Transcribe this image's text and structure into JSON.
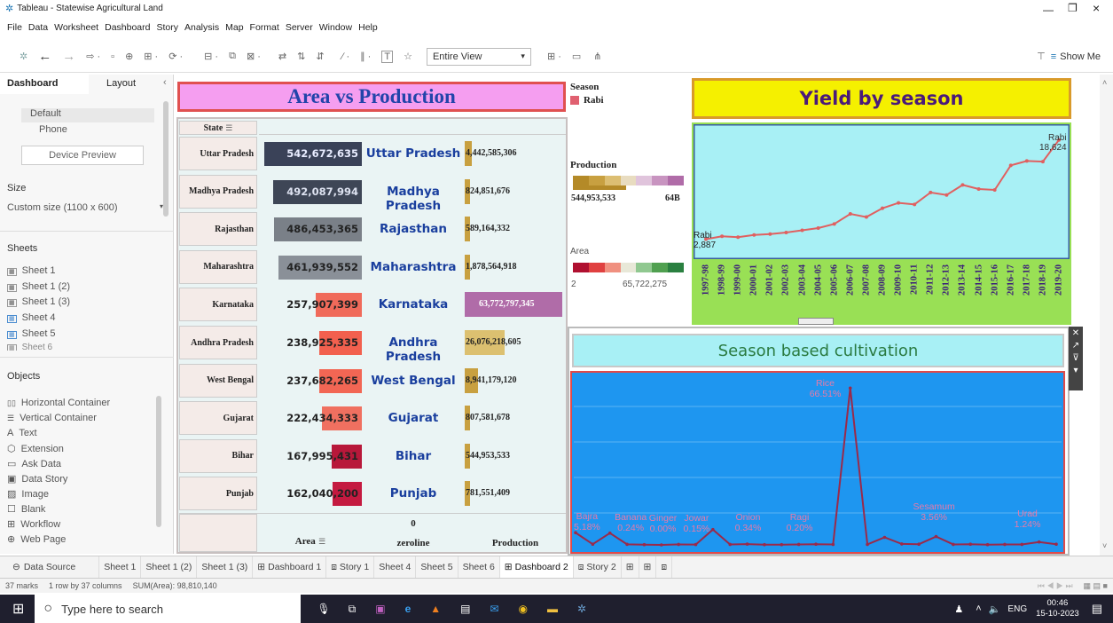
{
  "window": {
    "title": "Tableau - Statewise Agricultural Land"
  },
  "menu": [
    "File",
    "Data",
    "Worksheet",
    "Dashboard",
    "Story",
    "Analysis",
    "Map",
    "Format",
    "Server",
    "Window",
    "Help"
  ],
  "toolbar": {
    "fit": "Entire View",
    "show_me": "Show Me"
  },
  "left_panel": {
    "tab_dashboard": "Dashboard",
    "tab_layout": "Layout",
    "device_default": "Default",
    "device_phone": "Phone",
    "device_preview": "Device Preview",
    "size_label": "Size",
    "size_value": "Custom size (1100 x 600)",
    "sheets_label": "Sheets",
    "sheets": [
      "Sheet 1",
      "Sheet 1 (2)",
      "Sheet 1 (3)",
      "Sheet 4",
      "Sheet 5",
      "Sheet 6"
    ],
    "objects_label": "Objects",
    "objects": [
      "Horizontal Container",
      "Vertical Container",
      "Text",
      "Extension",
      "Ask Data",
      "Data Story",
      "Image",
      "Blank",
      "Workflow",
      "Web Page"
    ]
  },
  "dash": {
    "area_title": "Area vs Production",
    "state_header": "State",
    "area_header": "Area",
    "zero_header_value": "0",
    "zero_header": "zeroline",
    "prod_header": "Production",
    "season_legend_title": "Season",
    "season_legend_item": "Rabi",
    "prod_legend_title": "Production",
    "prod_legend_min": "544,953,533",
    "prod_legend_max": "64B",
    "area_legend_title": "Area",
    "area_legend_min": "2",
    "area_legend_max": "65,722,275",
    "yield_title": "Yield by season",
    "yield_start_label_season": "Rabi",
    "yield_start_label_value": "2,887",
    "yield_end_label_season": "Rabi",
    "yield_end_label_value": "18,624",
    "cult_title": "Season based cultivation",
    "state_rows": [
      {
        "state": "Uttar Pradesh",
        "area": "542,672,635",
        "production": "4,442,585,306"
      },
      {
        "state": "Madhya Pradesh",
        "area": "492,087,994",
        "production": "824,851,676"
      },
      {
        "state": "Rajasthan",
        "area": "486,453,365",
        "production": "589,164,332"
      },
      {
        "state": "Maharashtra",
        "area": "461,939,552",
        "production": "1,878,564,918"
      },
      {
        "state": "Karnataka",
        "area": "257,907,399",
        "production": "63,772,797,345"
      },
      {
        "state": "Andhra Pradesh",
        "area": "238,925,335",
        "production": "26,076,218,605"
      },
      {
        "state": "West Bengal",
        "area": "237,682,265",
        "production": "8,941,179,120"
      },
      {
        "state": "Gujarat",
        "area": "222,434,333",
        "production": "807,581,678"
      },
      {
        "state": "Bihar",
        "area": "167,995,431",
        "production": "544,953,533"
      },
      {
        "state": "Punjab",
        "area": "162,040,200",
        "production": "781,551,409"
      }
    ],
    "crop_labels": [
      {
        "crop": "Bajra",
        "pct": "5.18%"
      },
      {
        "crop": "Banana",
        "pct": "0.24%"
      },
      {
        "crop": "Ginger",
        "pct": "0.00%"
      },
      {
        "crop": "Jowar",
        "pct": "0.15%"
      },
      {
        "crop": "Onion",
        "pct": "0.34%"
      },
      {
        "crop": "Ragi",
        "pct": "0.20%"
      },
      {
        "crop": "Rice",
        "pct": "66.51%"
      },
      {
        "crop": "Sesamum",
        "pct": "3.56%"
      },
      {
        "crop": "Urad",
        "pct": "1.24%"
      }
    ]
  },
  "chart_data": [
    {
      "type": "bar",
      "title": "Area vs Production",
      "categories": [
        "Uttar Pradesh",
        "Madhya Pradesh",
        "Rajasthan",
        "Maharashtra",
        "Karnataka",
        "Andhra Pradesh",
        "West Bengal",
        "Gujarat",
        "Bihar",
        "Punjab"
      ],
      "series": [
        {
          "name": "Area",
          "values": [
            542672635,
            492087994,
            486453365,
            461939552,
            257907399,
            238925335,
            237682265,
            222434333,
            167995431,
            162040200
          ]
        },
        {
          "name": "Production",
          "values": [
            4442585306,
            824851676,
            589164332,
            1878564918,
            63772797345,
            26076218605,
            8941179120,
            807581678,
            544953533,
            781551409
          ]
        }
      ]
    },
    {
      "type": "line",
      "title": "Yield by season",
      "x": [
        "1997-98",
        "1998-99",
        "1999-00",
        "2000-01",
        "2001-02",
        "2002-03",
        "2003-04",
        "2004-05",
        "2005-06",
        "2006-07",
        "2007-08",
        "2008-09",
        "2009-10",
        "2010-11",
        "2011-12",
        "2012-13",
        "2013-14",
        "2014-15",
        "2015-16",
        "2016-17",
        "2017-18",
        "2018-19",
        "2019-20"
      ],
      "series": [
        {
          "name": "Rabi",
          "values": [
            2887,
            3350,
            3200,
            3550,
            3700,
            3950,
            4300,
            4650,
            5300,
            6900,
            6400,
            7800,
            8650,
            8400,
            10300,
            9900,
            11500,
            10850,
            10700,
            14600,
            15300,
            15200,
            18624
          ]
        }
      ]
    },
    {
      "type": "line",
      "title": "Season based cultivation",
      "x": [
        "Bajra",
        "",
        "",
        "Banana",
        "",
        "Ginger",
        "",
        "Jowar",
        "",
        "",
        "Onion",
        "",
        "",
        "Ragi",
        "",
        "",
        "Rice",
        "",
        "",
        "",
        "",
        "Sesamum",
        "",
        "",
        "",
        "",
        "",
        "Urad",
        ""
      ],
      "series": [
        {
          "values": [
            5.18,
            0.3,
            5.0,
            0.24,
            0.1,
            0.0,
            0.2,
            0.15,
            6.5,
            0.2,
            0.34,
            0.1,
            0.1,
            0.2,
            0.3,
            0.2,
            66.51,
            0.2,
            3.2,
            0.4,
            0.3,
            3.56,
            0.2,
            0.3,
            0.1,
            0.2,
            0.2,
            1.24,
            0.3
          ]
        }
      ]
    }
  ]
}
